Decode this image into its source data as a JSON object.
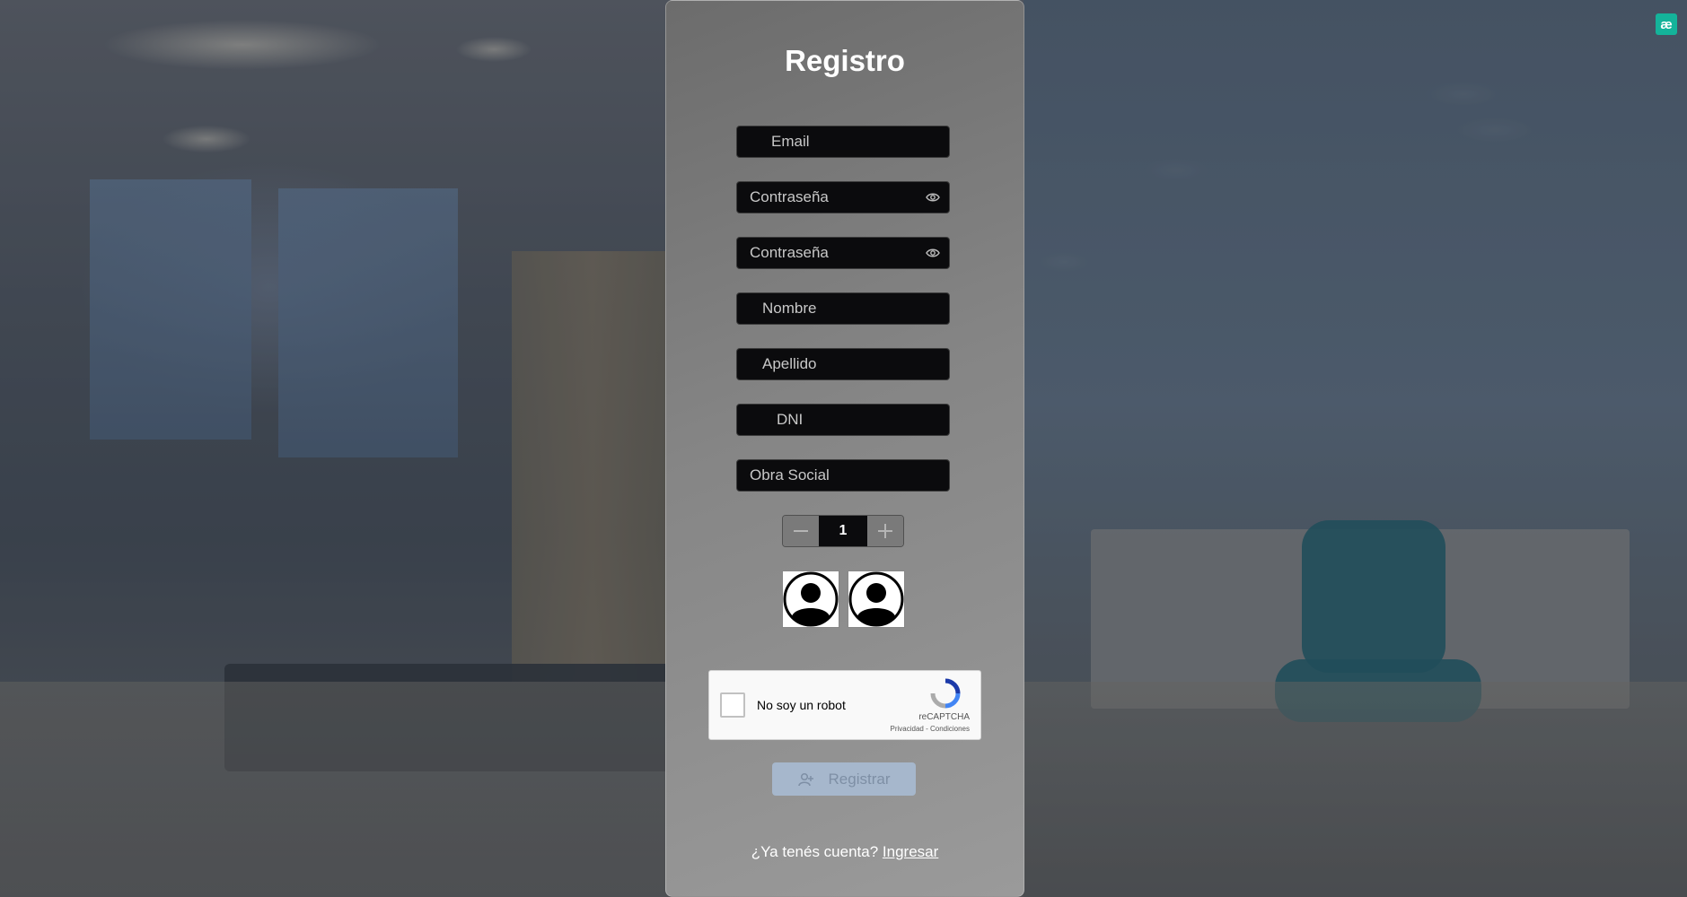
{
  "app": {
    "badge": "æ"
  },
  "form": {
    "title": "Registro",
    "email_placeholder": "Email",
    "password_placeholder": "Contraseña",
    "confirm_password_placeholder": "Contraseña",
    "nombre_placeholder": "Nombre",
    "apellido_placeholder": "Apellido",
    "dni_placeholder": "DNI",
    "obra_social_placeholder": "Obra Social",
    "stepper_value": "1",
    "captcha_label": "No soy un robot",
    "captcha_brand": "reCAPTCHA",
    "captcha_links": "Privacidad - Condiciones",
    "register_label": "Registrar",
    "footer_text": "¿Ya tenés cuenta?",
    "footer_link": "Ingresar"
  },
  "colors": {
    "badge": "#14b39a",
    "register_button": "#a6b7cc",
    "input_bg": "#0b0b0d"
  },
  "icons": [
    "eye-icon",
    "minus-icon",
    "plus-icon",
    "avatar-icon",
    "recaptcha-icon",
    "user-plus-icon"
  ]
}
